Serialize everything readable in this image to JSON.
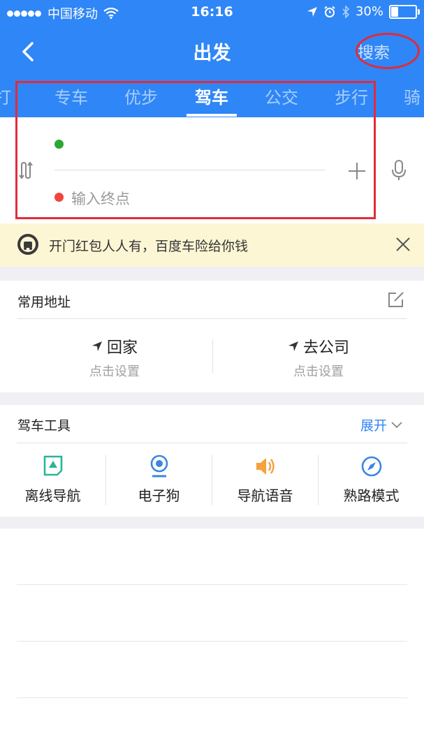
{
  "status_bar": {
    "carrier": "中国移动",
    "time": "16:16",
    "battery": "30%",
    "battery_level": 0.3
  },
  "nav": {
    "title": "出发",
    "search": "搜索"
  },
  "tabs": [
    "专车",
    "优步",
    "驾车",
    "公交",
    "步行"
  ],
  "active_tab": "驾车",
  "route": {
    "end_placeholder": "输入终点"
  },
  "promo": {
    "text": "开门红包人人有，百度车险给你钱"
  },
  "common_address": {
    "title": "常用地址",
    "home": {
      "label": "回家",
      "hint": "点击设置"
    },
    "work": {
      "label": "去公司",
      "hint": "点击设置"
    }
  },
  "driving_tools": {
    "title": "驾车工具",
    "expand": "展开",
    "items": [
      {
        "label": "离线导航",
        "icon": "offline-map-icon",
        "color": "#2bb59a"
      },
      {
        "label": "电子狗",
        "icon": "camera-icon",
        "color": "#3b86e6"
      },
      {
        "label": "导航语音",
        "icon": "speaker-icon",
        "color": "#f6a13a"
      },
      {
        "label": "熟路模式",
        "icon": "compass-icon",
        "color": "#3b86e6"
      }
    ]
  },
  "colors": {
    "header": "#2f86f6",
    "highlight": "#e22b3a",
    "start_dot": "#2aa832",
    "end_dot": "#f2453d",
    "promo_bg": "#fdf6d4"
  }
}
